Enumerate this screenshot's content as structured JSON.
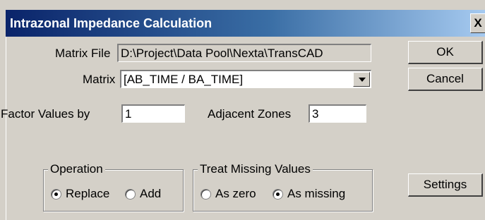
{
  "window": {
    "title": "Intrazonal Impedance Calculation",
    "close_glyph": "X"
  },
  "matrix_file": {
    "label": "Matrix File",
    "value": "D:\\Project\\Data Pool\\Nexta\\TransCAD"
  },
  "matrix": {
    "label": "Matrix",
    "selected": "[AB_TIME / BA_TIME]"
  },
  "factor": {
    "label": "Factor Values by",
    "value": "1"
  },
  "adjacent": {
    "label": "Adjacent Zones",
    "value": "3"
  },
  "buttons": {
    "ok": "OK",
    "cancel": "Cancel",
    "settings": "Settings"
  },
  "operation": {
    "legend": "Operation",
    "options": [
      {
        "label": "Replace",
        "checked": true
      },
      {
        "label": "Add",
        "checked": false
      }
    ]
  },
  "missing": {
    "legend": "Treat Missing Values",
    "options": [
      {
        "label": "As zero",
        "checked": false
      },
      {
        "label": "As missing",
        "checked": true
      }
    ]
  },
  "colors": {
    "face": "#d4d0c8",
    "title_start": "#0a246a",
    "title_end": "#a6caf0"
  }
}
